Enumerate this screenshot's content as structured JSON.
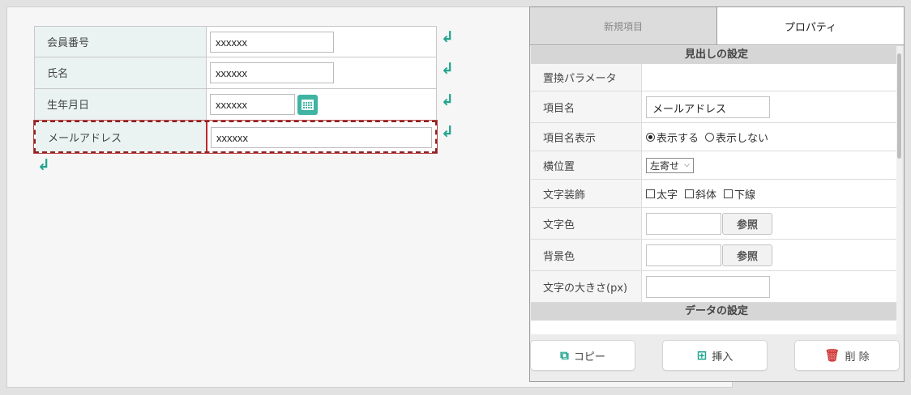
{
  "form": {
    "rows": [
      {
        "label": "会員番号",
        "value": "xxxxxx"
      },
      {
        "label": "氏名",
        "value": "xxxxxx"
      },
      {
        "label": "生年月日",
        "value": "xxxxxx"
      },
      {
        "label": "メールアドレス",
        "value": "xxxxxx"
      }
    ]
  },
  "icons": {
    "return": "↲",
    "calendar": "calendar-icon"
  },
  "panel": {
    "tabs": {
      "new_item": "新規項目",
      "properties": "プロパティ"
    },
    "heading_section": "見出しの設定",
    "data_section": "データの設定",
    "props": {
      "replace_param": "置換パラメータ",
      "item_name": "項目名",
      "item_name_value": "メールアドレス",
      "item_name_display": "項目名表示",
      "display_show": "表示する",
      "display_hide": "表示しない",
      "horizontal_pos": "横位置",
      "horizontal_pos_value": "左寄せ",
      "text_decoration": "文字装飾",
      "bold": "太字",
      "italic": "斜体",
      "underline": "下線",
      "text_color": "文字色",
      "background_color": "背景色",
      "ref": "参照",
      "font_size": "文字の大きさ(px)"
    },
    "actions": {
      "copy": "コピー",
      "insert": "挿入",
      "delete": "削 除"
    }
  },
  "colors": {
    "accent": "#21a58f",
    "delete": "#d13b3b",
    "selection": "#c02828"
  }
}
